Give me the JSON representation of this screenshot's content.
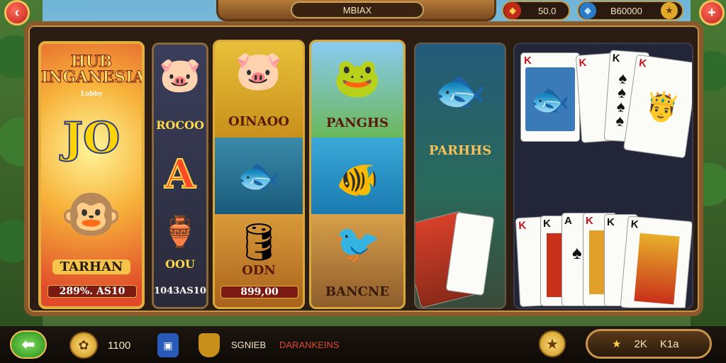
{
  "top": {
    "title": "MBIAX",
    "currency1": "50.0",
    "currency2": "B60000"
  },
  "games": [
    {
      "title": "HUB INGANESIA",
      "subtitle": "Lobby",
      "big": "JO",
      "name": "TARHAN",
      "value": "289%. AS10"
    },
    {
      "name1": "ROCOO",
      "big": "A",
      "name2": "OOU",
      "value": "1043AS10"
    },
    {
      "name1": "OINAOO",
      "name2": "ODN",
      "value": "899,00"
    },
    {
      "name1": "PANGHS",
      "name2": "BANCNE"
    },
    {
      "name1": "PARHHS"
    },
    {}
  ],
  "cards": {
    "top": [
      "K",
      "K",
      "K",
      "K"
    ],
    "bottom": [
      "K",
      "K",
      "A",
      "K",
      "K",
      "K"
    ]
  },
  "bottom": {
    "coins": "1100",
    "label1": "SGNIEB",
    "label2": "DARANKEINS",
    "right": "2K",
    "right2": "K1a"
  }
}
